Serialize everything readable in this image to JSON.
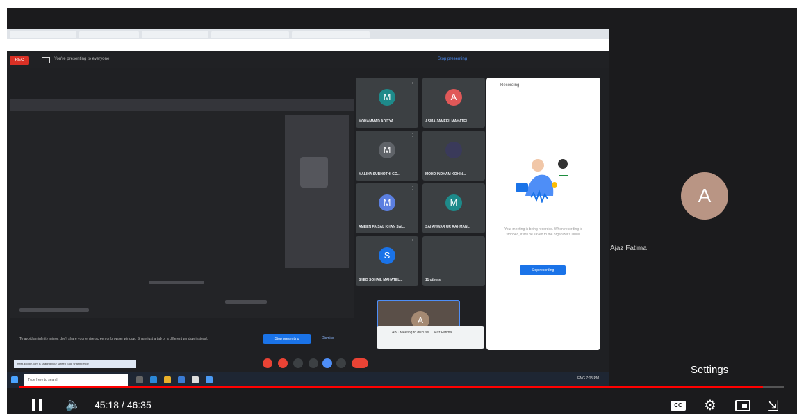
{
  "meet": {
    "rec_label": "REC",
    "presenting_text": "You're presenting to everyone",
    "stop_presenting": "Stop presenting",
    "share_notice": "To avoid an infinity mirror, don't share your entire screen or browser window. Share just a tab or a different window instead.",
    "share_button": "Stop presenting",
    "dismiss_button": "Dismiss",
    "toast_text": "ABC Meeting to discuss ... Ajaz Fatima",
    "participants": [
      {
        "initial": "M",
        "name": "MOHAMMAD ADITYA...",
        "color": "#1e8a8a"
      },
      {
        "initial": "A",
        "name": "ASMA JAMEEL MAHATEL...",
        "color": "#e05858"
      },
      {
        "initial": "M",
        "name": "MALIHA SUBHOTHI GO...",
        "color": "#5f6368"
      },
      {
        "initial": "",
        "name": "MOHD INDHAM KOHIN...",
        "color": "#3a3a5a"
      },
      {
        "initial": "M",
        "name": "AMEEN FAISAL KHAN SAI...",
        "color": "#5b7fe0"
      },
      {
        "initial": "M",
        "name": "SAI ANWAR UR RAHMAN...",
        "color": "#1e8a8a"
      },
      {
        "initial": "S",
        "name": "SYED SOHAIL MAHATEL...",
        "color": "#1a73e8"
      },
      {
        "initial": "",
        "name": "11 others",
        "color": "#3c4043"
      }
    ],
    "self_initial": "A",
    "recording_panel": {
      "title": "Recording",
      "description": "Your meeting is being recorded. When recording is stopped, it will be saved to the organizer's Drive.",
      "button": "Stop recording"
    },
    "taskbar_search": "Type here to search",
    "float_strip": "meet.google.com is sharing your screen  Stop sharing  Hide",
    "clock": "ENG 7:05 PM"
  },
  "viewer": {
    "initial": "A",
    "name": "Ajaz Fatima"
  },
  "player": {
    "settings_tooltip": "Settings",
    "time_current": "45:18",
    "time_separator": " / ",
    "time_total": "46:35",
    "progress_fraction": 0.9723,
    "cc_label": "CC"
  }
}
